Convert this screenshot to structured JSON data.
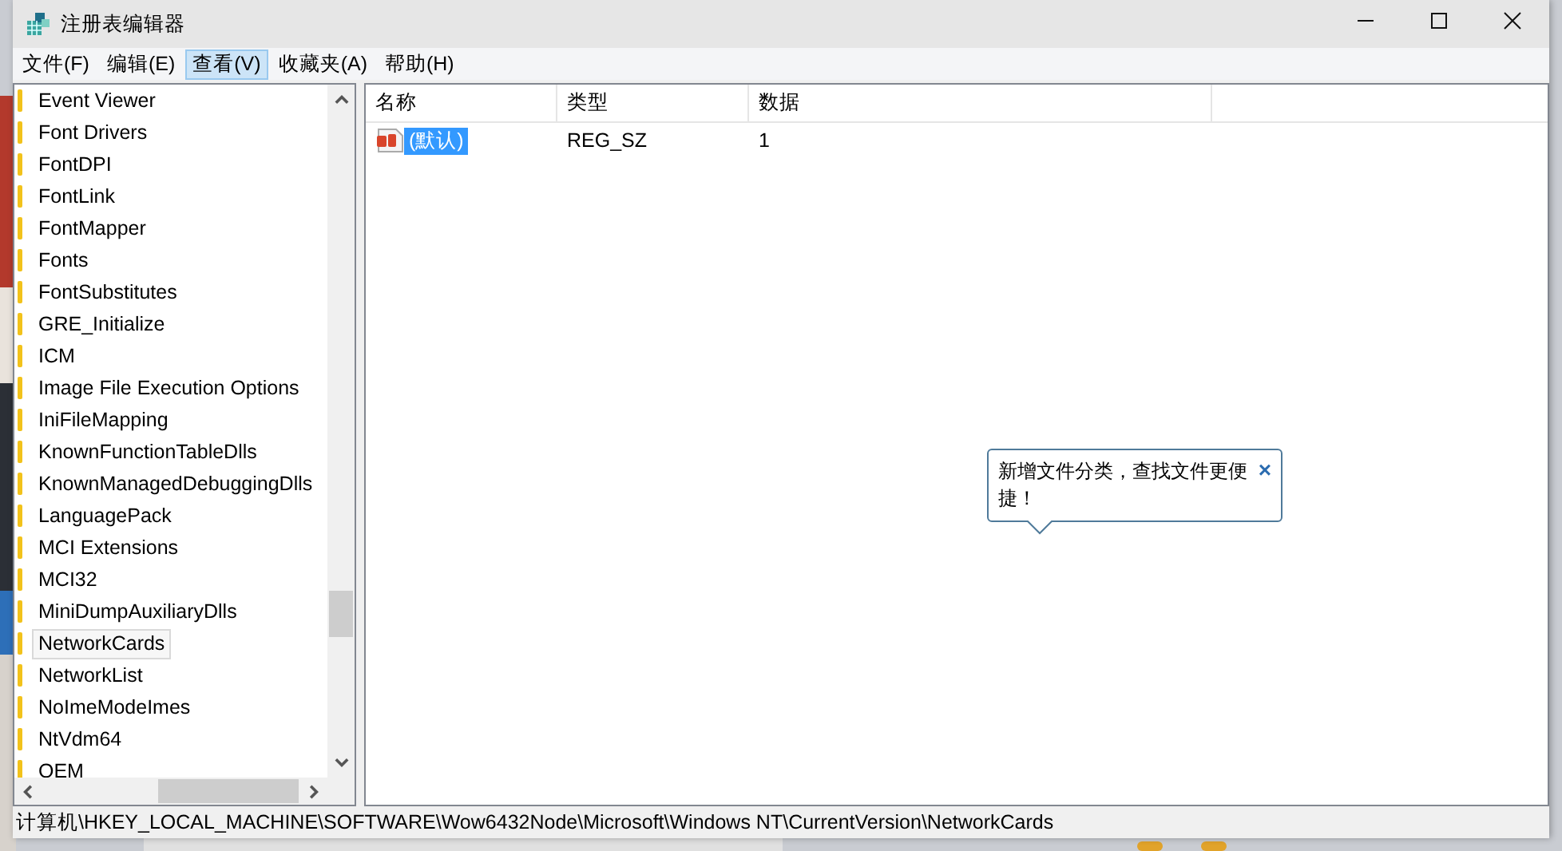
{
  "window": {
    "title": "注册表编辑器"
  },
  "menu": [
    {
      "label": "文件(F)",
      "selected": false
    },
    {
      "label": "编辑(E)",
      "selected": false
    },
    {
      "label": "查看(V)",
      "selected": true
    },
    {
      "label": "收藏夹(A)",
      "selected": false
    },
    {
      "label": "帮助(H)",
      "selected": false
    }
  ],
  "tree": {
    "items": [
      {
        "label": "Event Viewer",
        "selected": false
      },
      {
        "label": "Font Drivers",
        "selected": false
      },
      {
        "label": "FontDPI",
        "selected": false
      },
      {
        "label": "FontLink",
        "selected": false
      },
      {
        "label": "FontMapper",
        "selected": false
      },
      {
        "label": "Fonts",
        "selected": false
      },
      {
        "label": "FontSubstitutes",
        "selected": false
      },
      {
        "label": "GRE_Initialize",
        "selected": false
      },
      {
        "label": "ICM",
        "selected": false
      },
      {
        "label": "Image File Execution Options",
        "selected": false
      },
      {
        "label": "IniFileMapping",
        "selected": false
      },
      {
        "label": "KnownFunctionTableDlls",
        "selected": false
      },
      {
        "label": "KnownManagedDebuggingDlls",
        "selected": false
      },
      {
        "label": "LanguagePack",
        "selected": false
      },
      {
        "label": "MCI Extensions",
        "selected": false
      },
      {
        "label": "MCI32",
        "selected": false
      },
      {
        "label": "MiniDumpAuxiliaryDlls",
        "selected": false
      },
      {
        "label": "NetworkCards",
        "selected": true
      },
      {
        "label": "NetworkList",
        "selected": false
      },
      {
        "label": "NoImeModeImes",
        "selected": false
      },
      {
        "label": "NtVdm64",
        "selected": false
      },
      {
        "label": "OEM",
        "selected": false
      }
    ]
  },
  "table": {
    "columns": [
      "名称",
      "类型",
      "数据"
    ],
    "rows": [
      {
        "name": "(默认)",
        "type": "REG_SZ",
        "data": "1",
        "selected": true
      }
    ]
  },
  "tooltip": {
    "text": "新增文件分类，查找文件更便捷！",
    "close": "×"
  },
  "status_bar": "计算机\\HKEY_LOCAL_MACHINE\\SOFTWARE\\Wow6432Node\\Microsoft\\Windows NT\\CurrentVersion\\NetworkCards"
}
